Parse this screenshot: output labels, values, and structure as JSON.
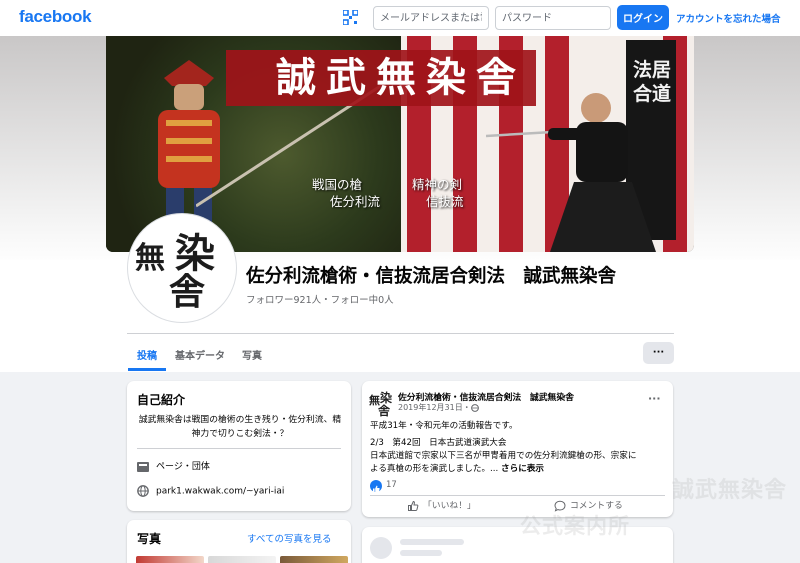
{
  "topbar": {
    "logo": "facebook",
    "email_placeholder": "メールアドレスまたは電話番号",
    "password_placeholder": "パスワード",
    "login_label": "ログイン",
    "forgot_label": "アカウントを忘れた場合"
  },
  "cover": {
    "title": "誠武無染舎",
    "caption_left_1": "戦国の槍",
    "caption_left_2": "佐分利流",
    "caption_right_1": "精神の剣",
    "caption_right_2": "信抜流",
    "banner_text": "法居合道"
  },
  "avatar": {
    "char_1": "無",
    "char_2": "染",
    "char_3": "舎"
  },
  "profile": {
    "name": "佐分利流槍術・信抜流居合剣法　誠武無染舎",
    "followers": "フォロワー921人・フォロー中0人"
  },
  "tabs": [
    {
      "label": "投稿"
    },
    {
      "label": "基本データ"
    },
    {
      "label": "写真"
    }
  ],
  "more_label": "···",
  "intro": {
    "title": "自己紹介",
    "text": "誠武無染舎は戦国の槍術の生き残り・佐分利流、精神力で切りこむ剣法・？",
    "category": "ページ・団体",
    "website": "park1.wakwak.com/~yari-iai"
  },
  "photos": {
    "title": "写真",
    "see_all": "すべての写真を見る"
  },
  "post": {
    "author": "佐分利流槍術・信抜流居合剣法　誠武無染舎",
    "date": "2019年12月31日・",
    "line1": "平成31年・令和元年の活動報告です。",
    "line2": "2/3　第42回　日本古武道演武大会",
    "line3": "日本武道館で宗家以下三名が甲冑着用での佐分利流鍵槍の形、宗家に",
    "line4": "よる真槍の形を演武しました。...",
    "see_more": "さらに表示",
    "likes": "17",
    "like_action": "「いいね！」",
    "comment_action": "コメントする",
    "more": "···"
  },
  "watermark": {
    "line1": "誠武無染舎",
    "line2": "公式案内所"
  },
  "colors": {
    "brand": "#1877f2",
    "background": "#f0f2f5",
    "secondary_text": "#65676b"
  }
}
